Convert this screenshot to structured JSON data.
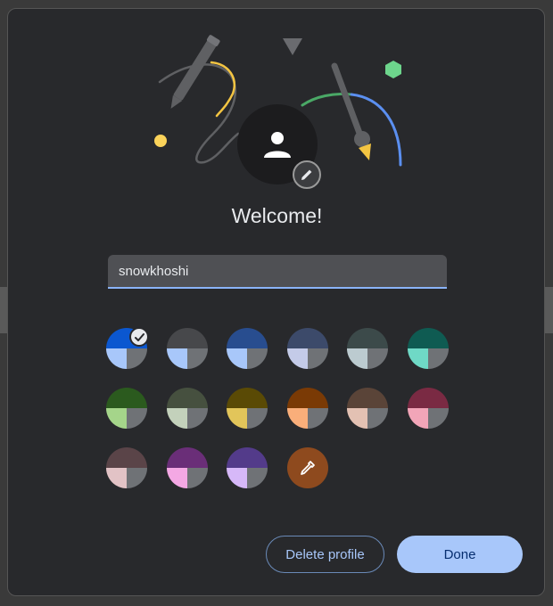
{
  "dialog": {
    "title": "Welcome!",
    "name_value": "snowkhoshi"
  },
  "swatches": [
    {
      "top": "#0b57d0",
      "bl": "#a8c7fa",
      "br": "#6f7276",
      "selected": true
    },
    {
      "top": "#47484b",
      "bl": "#a8c7fa",
      "br": "#6f7276"
    },
    {
      "top": "#284d8f",
      "bl": "#a8c7fa",
      "br": "#6f7276"
    },
    {
      "top": "#3c4a6a",
      "bl": "#c4cbe8",
      "br": "#6f7276"
    },
    {
      "top": "#3c4a4a",
      "bl": "#bccbd0",
      "br": "#6f7276"
    },
    {
      "top": "#0f5b52",
      "bl": "#6fd9c6",
      "br": "#6f7276"
    },
    {
      "top": "#2b5a1e",
      "bl": "#a5d58a",
      "br": "#6f7276"
    },
    {
      "top": "#46503f",
      "bl": "#c3d1bb",
      "br": "#6f7276"
    },
    {
      "top": "#5a4a05",
      "bl": "#e2c55a",
      "br": "#6f7276"
    },
    {
      "top": "#7a3a05",
      "bl": "#f9ae7a",
      "br": "#6f7276"
    },
    {
      "top": "#5a4438",
      "bl": "#e3c1b3",
      "br": "#6f7276"
    },
    {
      "top": "#7a2a43",
      "bl": "#f2a5b8",
      "br": "#6f7276"
    },
    {
      "top": "#5a4448",
      "bl": "#e2c3c6",
      "br": "#6f7276"
    },
    {
      "top": "#6a2e78",
      "bl": "#f4a8e4",
      "br": "#6f7276"
    },
    {
      "top": "#533b8a",
      "bl": "#d6b8f8",
      "br": "#6f7276"
    }
  ],
  "buttons": {
    "delete_label": "Delete profile",
    "done_label": "Done"
  },
  "icons": {
    "avatar": "person-icon",
    "edit": "pencil-icon",
    "selected": "checkmark-icon",
    "picker": "eyedropper-icon"
  },
  "colors": {
    "accent": "#a8c7fa",
    "picker_bg": "#8e4a1e",
    "dialog_bg": "#28292c"
  }
}
